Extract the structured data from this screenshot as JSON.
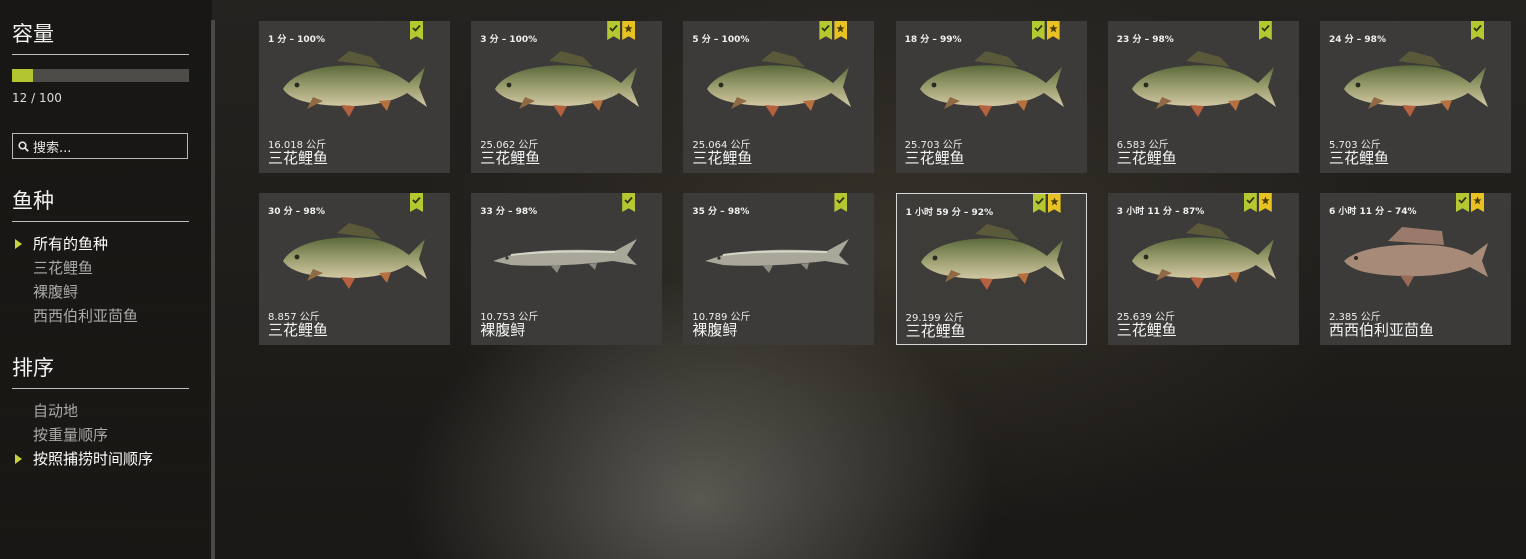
{
  "sidebar": {
    "capacity_title": "容量",
    "capacity": {
      "current": 12,
      "max": 100,
      "text": "12 / 100"
    },
    "search_placeholder": "搜索...",
    "species_title": "鱼种",
    "species_items": [
      {
        "label": "所有的鱼种",
        "active": true
      },
      {
        "label": "三花鲤鱼",
        "active": false
      },
      {
        "label": "裸腹鲟",
        "active": false
      },
      {
        "label": "西西伯利亚茴鱼",
        "active": false
      }
    ],
    "sort_title": "排序",
    "sort_items": [
      {
        "label": "自动地",
        "active": false
      },
      {
        "label": "按重量顺序",
        "active": false
      },
      {
        "label": "按照捕捞时间顺序",
        "active": true
      }
    ]
  },
  "colors": {
    "accent": "#b3c531",
    "gold": "#e8c222",
    "card": "#3c3b39"
  },
  "fish_cards": [
    {
      "meta": "1 分 – 100%",
      "weight": "16.018 公斤",
      "name": "三花鲤鱼",
      "fish": "carp",
      "badges": [
        "check"
      ]
    },
    {
      "meta": "3 分 – 100%",
      "weight": "25.062 公斤",
      "name": "三花鲤鱼",
      "fish": "carp",
      "badges": [
        "check",
        "star"
      ]
    },
    {
      "meta": "5 分 – 100%",
      "weight": "25.064 公斤",
      "name": "三花鲤鱼",
      "fish": "carp",
      "badges": [
        "check",
        "star"
      ]
    },
    {
      "meta": "18 分 – 99%",
      "weight": "25.703 公斤",
      "name": "三花鲤鱼",
      "fish": "carp",
      "badges": [
        "check",
        "star"
      ]
    },
    {
      "meta": "23 分 – 98%",
      "weight": "6.583 公斤",
      "name": "三花鲤鱼",
      "fish": "carp",
      "badges": [
        "check"
      ]
    },
    {
      "meta": "24 分 – 98%",
      "weight": "5.703 公斤",
      "name": "三花鲤鱼",
      "fish": "carp",
      "badges": [
        "check"
      ]
    },
    {
      "meta": "30 分 – 98%",
      "weight": "8.857 公斤",
      "name": "三花鲤鱼",
      "fish": "carp",
      "badges": [
        "check"
      ]
    },
    {
      "meta": "33 分 – 98%",
      "weight": "10.753 公斤",
      "name": "裸腹鲟",
      "fish": "sturgeon",
      "badges": [
        "check"
      ]
    },
    {
      "meta": "35 分 – 98%",
      "weight": "10.789 公斤",
      "name": "裸腹鲟",
      "fish": "sturgeon",
      "badges": [
        "check"
      ]
    },
    {
      "meta": "1 小时 59 分 – 92%",
      "weight": "29.199 公斤",
      "name": "三花鲤鱼",
      "fish": "carp",
      "badges": [
        "check",
        "star"
      ],
      "selected": true
    },
    {
      "meta": "3 小时 11 分 – 87%",
      "weight": "25.639 公斤",
      "name": "三花鲤鱼",
      "fish": "carp",
      "badges": [
        "check",
        "star"
      ]
    },
    {
      "meta": "6 小时 11 分 – 74%",
      "weight": "2.385 公斤",
      "name": "西西伯利亚茴鱼",
      "fish": "grayling",
      "badges": [
        "check",
        "star"
      ]
    }
  ]
}
